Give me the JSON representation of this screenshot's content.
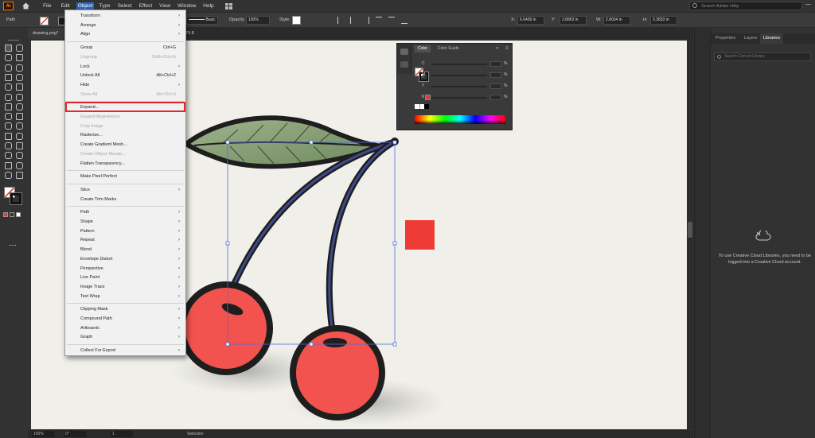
{
  "menubar": {
    "logo": "Ai",
    "items": [
      "File",
      "Edit",
      "Object",
      "Type",
      "Select",
      "Effect",
      "View",
      "Window",
      "Help"
    ],
    "active_item": "Object",
    "search_placeholder": "Search Adobe Help"
  },
  "controlbar": {
    "selection_label": "Path",
    "stroke_style": "Basic",
    "opacity_label": "Opacity:",
    "opacity_value": "100%",
    "style_label": "Style:",
    "x_label": "X:",
    "x_value": "6.6439 in",
    "y_label": "Y:",
    "y_value": "3.8863 in",
    "w_label": "W:",
    "w_value": "2.8034 in",
    "h_label": "H:",
    "h_value": "3.3833 in"
  },
  "tabs": {
    "doc_tab": "drawing.png*",
    "doc_tab_suffix": "% (RGB/Preview)",
    "doc_zoom": "79.8"
  },
  "object_menu": {
    "items": [
      {
        "label": "Transform",
        "shortcut": "",
        "submenu": true,
        "disabled": false
      },
      {
        "label": "Arrange",
        "shortcut": "",
        "submenu": true,
        "disabled": false
      },
      {
        "label": "Align",
        "shortcut": "",
        "submenu": true,
        "disabled": false
      },
      {
        "label": "Group",
        "shortcut": "Ctrl+G",
        "submenu": false,
        "disabled": false
      },
      {
        "label": "Ungroup",
        "shortcut": "Shift+Ctrl+G",
        "submenu": false,
        "disabled": true
      },
      {
        "label": "Lock",
        "shortcut": "",
        "submenu": true,
        "disabled": false
      },
      {
        "label": "Unlock All",
        "shortcut": "Alt+Ctrl+2",
        "submenu": false,
        "disabled": false
      },
      {
        "label": "Hide",
        "shortcut": "",
        "submenu": true,
        "disabled": false
      },
      {
        "label": "Show All",
        "shortcut": "Alt+Ctrl+3",
        "submenu": false,
        "disabled": true
      },
      {
        "label": "Expand...",
        "shortcut": "",
        "submenu": false,
        "disabled": false
      },
      {
        "label": "Expand Appearance",
        "shortcut": "",
        "submenu": false,
        "disabled": true
      },
      {
        "label": "Crop Image",
        "shortcut": "",
        "submenu": false,
        "disabled": true
      },
      {
        "label": "Rasterize...",
        "shortcut": "",
        "submenu": false,
        "disabled": false
      },
      {
        "label": "Create Gradient Mesh...",
        "shortcut": "",
        "submenu": false,
        "disabled": false
      },
      {
        "label": "Create Object Mosaic...",
        "shortcut": "",
        "submenu": false,
        "disabled": true
      },
      {
        "label": "Flatten Transparency...",
        "shortcut": "",
        "submenu": false,
        "disabled": false
      },
      {
        "label": "Make Pixel Perfect",
        "shortcut": "",
        "submenu": false,
        "disabled": false
      },
      {
        "label": "Slice",
        "shortcut": "",
        "submenu": true,
        "disabled": false
      },
      {
        "label": "Create Trim Marks",
        "shortcut": "",
        "submenu": false,
        "disabled": false
      },
      {
        "label": "Path",
        "shortcut": "",
        "submenu": true,
        "disabled": false
      },
      {
        "label": "Shape",
        "shortcut": "",
        "submenu": true,
        "disabled": false
      },
      {
        "label": "Pattern",
        "shortcut": "",
        "submenu": true,
        "disabled": false
      },
      {
        "label": "Repeat",
        "shortcut": "",
        "submenu": true,
        "disabled": false
      },
      {
        "label": "Blend",
        "shortcut": "",
        "submenu": true,
        "disabled": false
      },
      {
        "label": "Envelope Distort",
        "shortcut": "",
        "submenu": true,
        "disabled": false
      },
      {
        "label": "Perspective",
        "shortcut": "",
        "submenu": true,
        "disabled": false
      },
      {
        "label": "Live Paint",
        "shortcut": "",
        "submenu": true,
        "disabled": false
      },
      {
        "label": "Image Trace",
        "shortcut": "",
        "submenu": true,
        "disabled": false
      },
      {
        "label": "Text Wrap",
        "shortcut": "",
        "submenu": true,
        "disabled": false
      },
      {
        "label": "Clipping Mask",
        "shortcut": "",
        "submenu": true,
        "disabled": false
      },
      {
        "label": "Compound Path",
        "shortcut": "",
        "submenu": true,
        "disabled": false
      },
      {
        "label": "Artboards",
        "shortcut": "",
        "submenu": true,
        "disabled": false
      },
      {
        "label": "Graph",
        "shortcut": "",
        "submenu": true,
        "disabled": false
      },
      {
        "label": "Collect For Export",
        "shortcut": "",
        "submenu": true,
        "disabled": false
      }
    ],
    "highlighted_item": "Expand..."
  },
  "color_panel": {
    "tabs": [
      "Color",
      "Color Guide"
    ],
    "active_tab": "Color",
    "channels": [
      {
        "label": "C",
        "unit": "%"
      },
      {
        "label": "M",
        "unit": "%"
      },
      {
        "label": "Y",
        "unit": "%"
      },
      {
        "label": "K",
        "unit": "%"
      }
    ]
  },
  "right_panel": {
    "tabs": [
      "Properties",
      "Layers",
      "Libraries"
    ],
    "active_tab": "Libraries",
    "search_placeholder": "Search Current Library",
    "message": "To use Creative Cloud Libraries, you need to be logged into a Creative Cloud account."
  },
  "statusbar": {
    "zoom": "150%",
    "rotation": "0°",
    "artboard": "1",
    "tool": "Selection"
  },
  "colors": {
    "cherry_red": "#f2534f",
    "outline": "#1e1e1e",
    "leaf_green": "#8ba27a",
    "menu_highlight": "#e0292e",
    "selection_blue": "#4f6fd8",
    "square_red": "#ef3b35"
  }
}
